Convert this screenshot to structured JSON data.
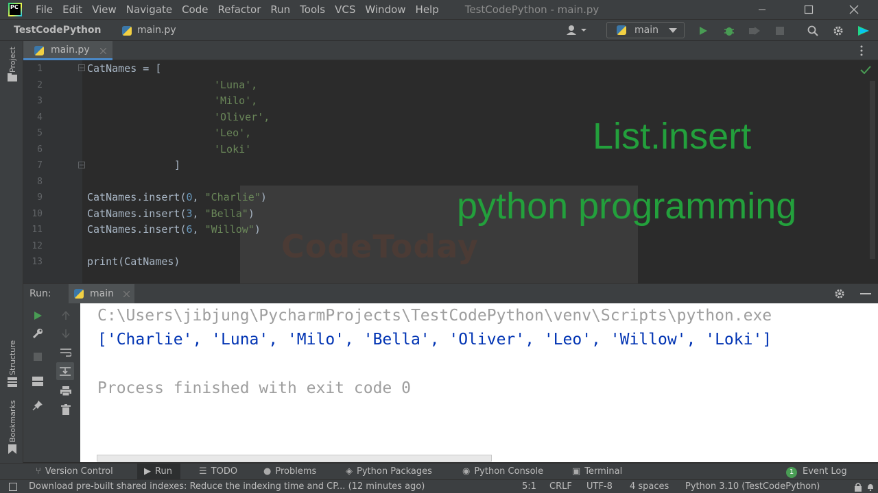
{
  "menu": {
    "items": [
      "File",
      "Edit",
      "View",
      "Navigate",
      "Code",
      "Refactor",
      "Run",
      "Tools",
      "VCS",
      "Window",
      "Help"
    ],
    "window_title": "TestCodePython - main.py",
    "logo_text": "PC"
  },
  "navbar": {
    "project": "TestCodePython",
    "file": "main.py",
    "run_config": "main"
  },
  "left_strip": {
    "project_label": "Project",
    "structure_label": "Structure",
    "bookmarks_label": "Bookmarks"
  },
  "editor": {
    "tab_label": "main.py",
    "line_numbers": [
      "1",
      "2",
      "3",
      "4",
      "5",
      "6",
      "7",
      "8",
      "9",
      "10",
      "11",
      "12",
      "13"
    ],
    "lines": {
      "l1": "CatNames = [",
      "l2": "'Luna',",
      "l3": "'Milo',",
      "l4": "'Oliver',",
      "l5": "'Leo',",
      "l6": "'Loki'",
      "l7": "]",
      "l9_a": "CatNames.insert(",
      "l9_b": "0",
      "l9_c": ", ",
      "l9_d": "\"Charlie\"",
      "l9_e": ")",
      "l10_a": "CatNames.insert(",
      "l10_b": "3",
      "l10_c": ", ",
      "l10_d": "\"Bella\"",
      "l10_e": ")",
      "l11_a": "CatNames.insert(",
      "l11_b": "6",
      "l11_c": ", ",
      "l11_d": "\"Willow\"",
      "l11_e": ")",
      "l13": "print(CatNames)"
    }
  },
  "overlay": {
    "title": "List.insert",
    "subtitle": "python programming",
    "watermark": "CodeToday"
  },
  "run_panel": {
    "label": "Run:",
    "tab": "main",
    "console_lines": {
      "path": "C:\\Users\\jibjung\\PycharmProjects\\TestCodePython\\venv\\Scripts\\python.exe",
      "output": "['Charlie', 'Luna', 'Milo', 'Bella', 'Oliver', 'Leo', 'Willow', 'Loki']",
      "finished": "Process finished with exit code 0"
    }
  },
  "tool_windows": {
    "version_control": "Version Control",
    "run": "Run",
    "todo": "TODO",
    "problems": "Problems",
    "python_packages": "Python Packages",
    "python_console": "Python Console",
    "terminal": "Terminal",
    "event_log": "Event Log",
    "event_log_count": "1"
  },
  "status": {
    "message": "Download pre-built shared indexes: Reduce the indexing time and CP... (12 minutes ago)",
    "position": "5:1",
    "line_sep": "CRLF",
    "encoding": "UTF-8",
    "indent": "4 spaces",
    "interpreter": "Python 3.10 (TestCodePython)"
  },
  "colors": {
    "overlay_green": "#23a03c",
    "run_green": "#499c54",
    "output_blue": "#0033b3",
    "console_gray": "#9e9e9e"
  }
}
